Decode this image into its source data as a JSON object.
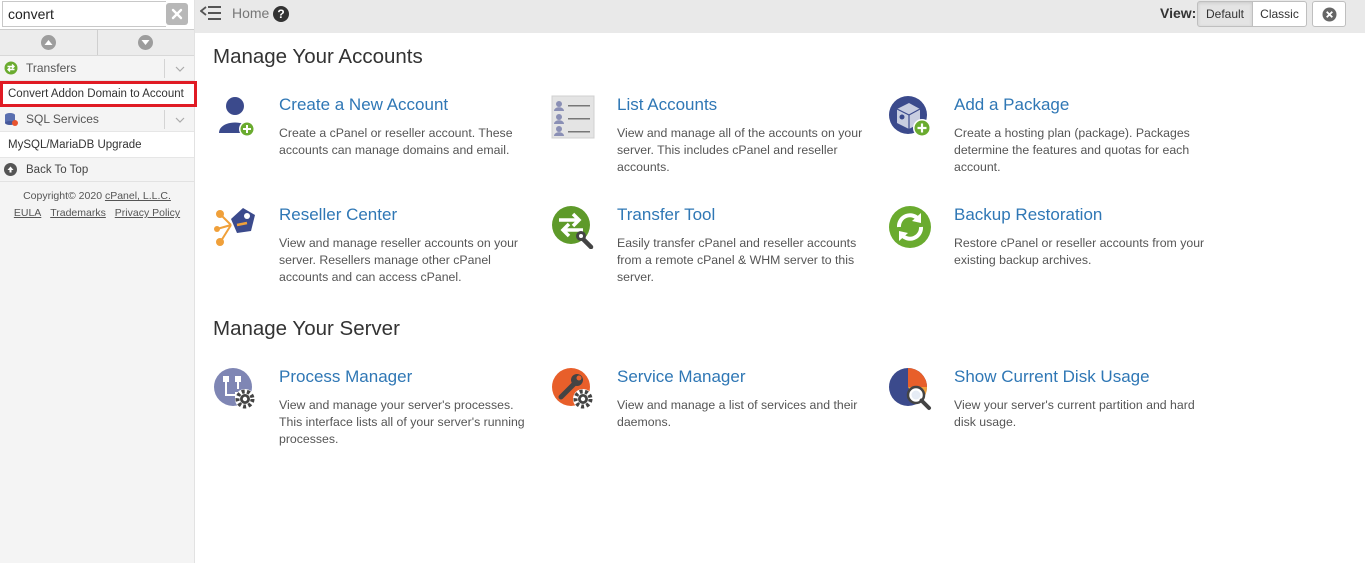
{
  "sidebar": {
    "search": {
      "value": "convert",
      "placeholder": ""
    },
    "categories": [
      {
        "label": "Transfers",
        "icon": "transfers-icon"
      },
      {
        "label": "SQL Services",
        "icon": "database-icon"
      }
    ],
    "links": {
      "convert_addon": "Convert Addon Domain to Account",
      "mysql_upgrade": "MySQL/MariaDB Upgrade"
    },
    "back_to_top": "Back To Top",
    "copyright": {
      "prefix": "Copyright© 2020",
      "company": "cPanel, L.L.C.",
      "eula": "EULA",
      "trademarks": "Trademarks",
      "privacy": "Privacy Policy"
    }
  },
  "topbar": {
    "home": "Home",
    "help": "?",
    "view_label": "View:",
    "default_btn": "Default",
    "classic_btn": "Classic"
  },
  "main": {
    "accounts_title": "Manage Your Accounts",
    "server_title": "Manage Your Server",
    "accounts": [
      {
        "title": "Create a New Account",
        "desc": "Create a cPanel or reseller account. These accounts can manage domains and email.",
        "icon": "user-add-icon"
      },
      {
        "title": "List Accounts",
        "desc": "View and manage all of the accounts on your server. This includes cPanel and reseller accounts.",
        "icon": "list-accounts-icon"
      },
      {
        "title": "Add a Package",
        "desc": "Create a hosting plan (package). Packages determine the features and quotas for each account.",
        "icon": "package-add-icon"
      },
      {
        "title": "Reseller Center",
        "desc": "View and manage reseller accounts on your server. Resellers manage other cPanel accounts and can access cPanel.",
        "icon": "reseller-tag-icon"
      },
      {
        "title": "Transfer Tool",
        "desc": "Easily transfer cPanel and reseller accounts from a remote cPanel & WHM server to this server.",
        "icon": "transfer-tool-icon"
      },
      {
        "title": "Backup Restoration",
        "desc": "Restore cPanel or reseller accounts from your existing backup archives.",
        "icon": "backup-restore-icon"
      }
    ],
    "server": [
      {
        "title": "Process Manager",
        "desc": "View and manage your server's processes. This interface lists all of your server's running processes.",
        "icon": "process-gear-icon"
      },
      {
        "title": "Service Manager",
        "desc": "View and manage a list of services and their daemons.",
        "icon": "service-wrench-icon"
      },
      {
        "title": "Show Current Disk Usage",
        "desc": "View your server's current partition and hard disk usage.",
        "icon": "disk-usage-icon"
      }
    ]
  },
  "colors": {
    "link": "#2f77b5",
    "highlight_border": "#e01b24",
    "green_icon": "#6aab2f"
  }
}
